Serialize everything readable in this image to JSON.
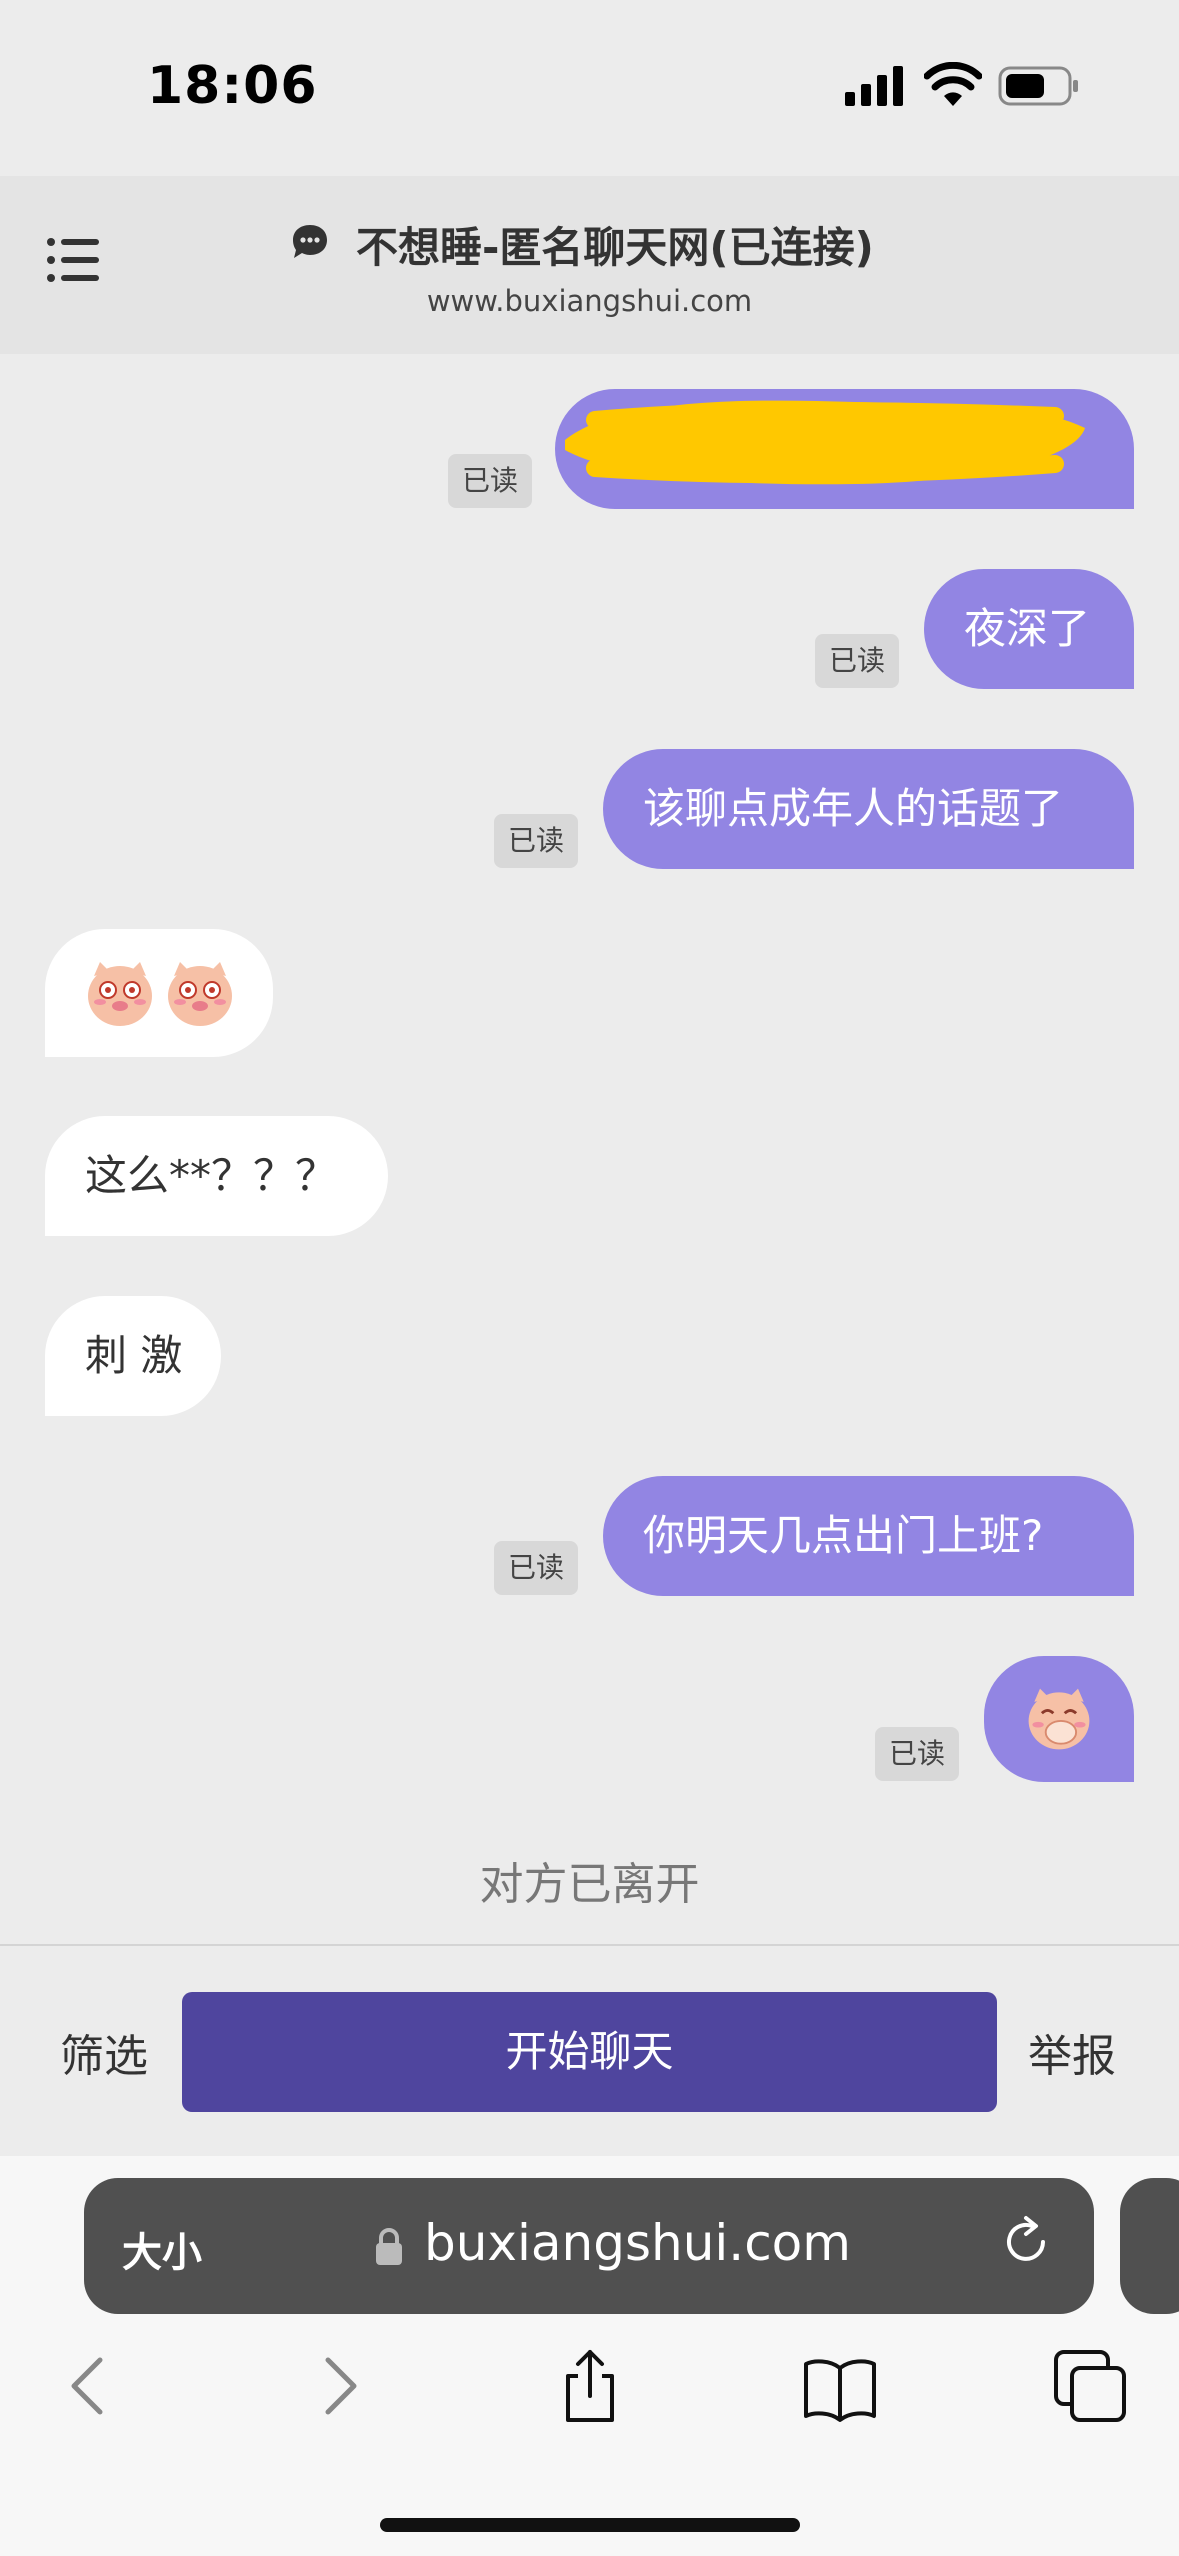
{
  "status_bar": {
    "time": "18:06"
  },
  "header": {
    "title": "不想睡-匿名聊天网(已连接)",
    "subtitle": "www.buxiangshui.com"
  },
  "messages": [
    {
      "side": "mine",
      "text": "",
      "read": "已读",
      "redacted": true
    },
    {
      "side": "mine",
      "text": "夜深了",
      "read": "已读"
    },
    {
      "side": "mine",
      "text": "该聊点成年人的话题了",
      "read": "已读"
    },
    {
      "side": "theirs",
      "emoji": "pig-emoji-pair"
    },
    {
      "side": "theirs",
      "text": "这么**？？？"
    },
    {
      "side": "theirs",
      "text": "刺 激"
    },
    {
      "side": "mine",
      "text": "你明天几点出门上班?",
      "read": "已读"
    },
    {
      "side": "mine",
      "emoji": "pig-cover-mouth-emoji",
      "read": "已读"
    }
  ],
  "notice": "对方已离开",
  "actions": {
    "filter": "筛选",
    "start": "开始聊天",
    "report": "举报"
  },
  "browser": {
    "text_size": "大小",
    "url": "buxiangshui.com"
  },
  "colors": {
    "mine_bubble": "#9285e3",
    "start_button": "#4f459e",
    "redaction": "#ffc800"
  }
}
